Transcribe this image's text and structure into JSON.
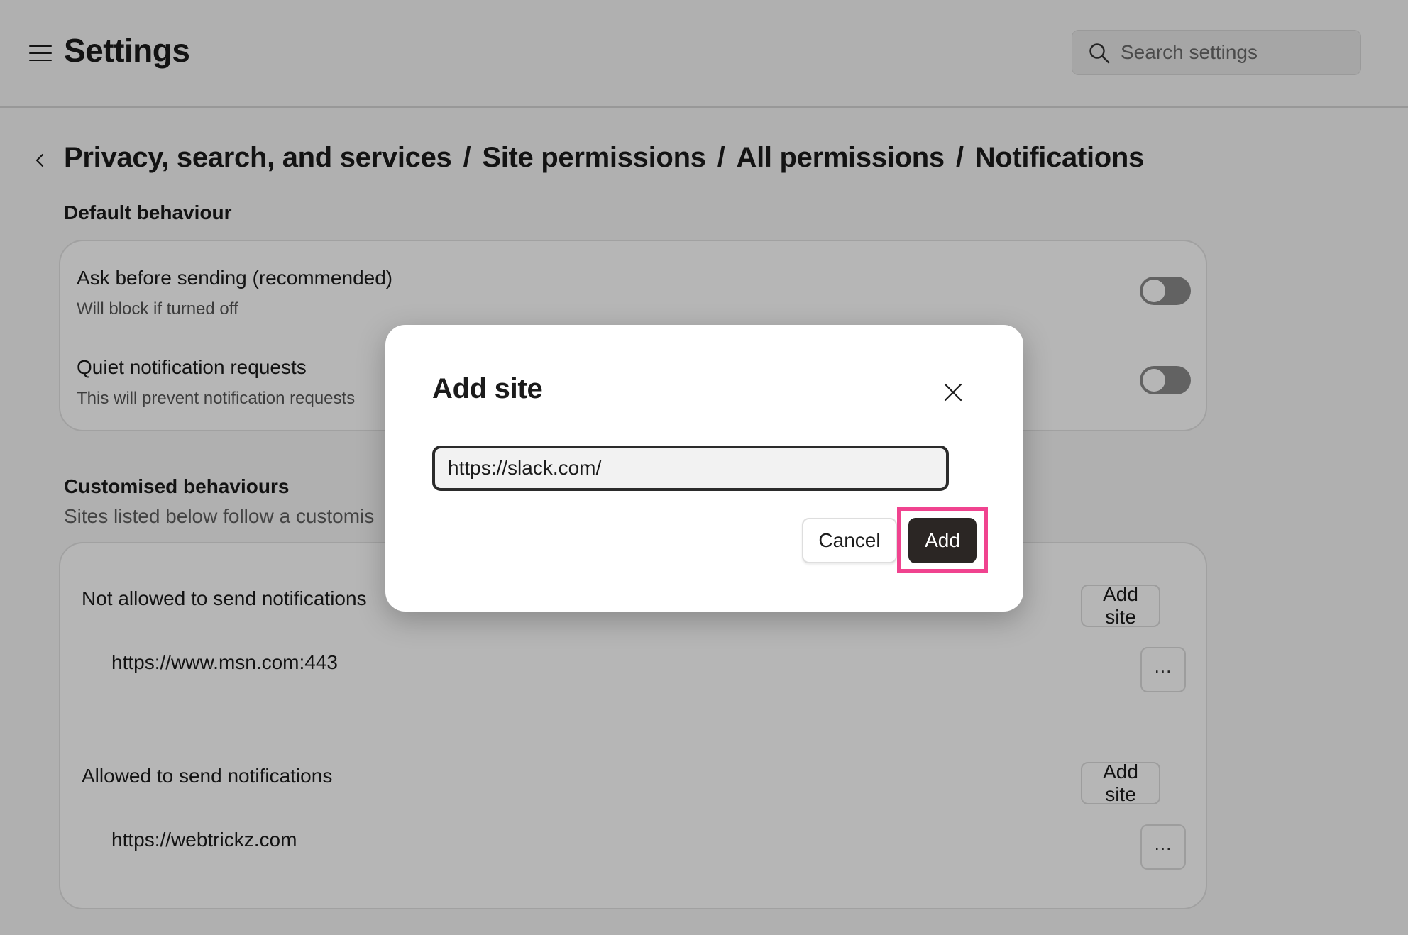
{
  "header": {
    "title": "Settings",
    "search_placeholder": "Search settings"
  },
  "breadcrumb": [
    "Privacy, search, and services",
    "Site permissions",
    "All permissions",
    "Notifications"
  ],
  "breadcrumb_separator": "/",
  "default_behaviour": {
    "title": "Default behaviour",
    "rows": [
      {
        "title": "Ask before sending (recommended)",
        "subtitle": "Will block if turned off",
        "enabled": false
      },
      {
        "title": "Quiet notification requests",
        "subtitle": "This will prevent notification requests",
        "enabled": false
      }
    ]
  },
  "customised_behaviours": {
    "title": "Customised behaviours",
    "description": "Sites listed below follow a customis",
    "groups": [
      {
        "title": "Not allowed to send notifications",
        "add_label": "Add site",
        "sites": [
          "https://www.msn.com:443"
        ]
      },
      {
        "title": "Allowed to send notifications",
        "add_label": "Add site",
        "sites": [
          "https://webtrickz.com"
        ]
      }
    ],
    "more_label": "..."
  },
  "dialog": {
    "title": "Add site",
    "url_value": "https://slack.com/",
    "cancel_label": "Cancel",
    "add_label": "Add"
  },
  "colors": {
    "overlay": "rgba(0,0,0,0.285)",
    "primary_button": "#2b2624",
    "highlight": "#f0438f",
    "toggle_off": "#8a8a8a"
  },
  "icons": [
    "menu-icon",
    "search-icon",
    "back-icon",
    "close-icon",
    "more-icon"
  ]
}
